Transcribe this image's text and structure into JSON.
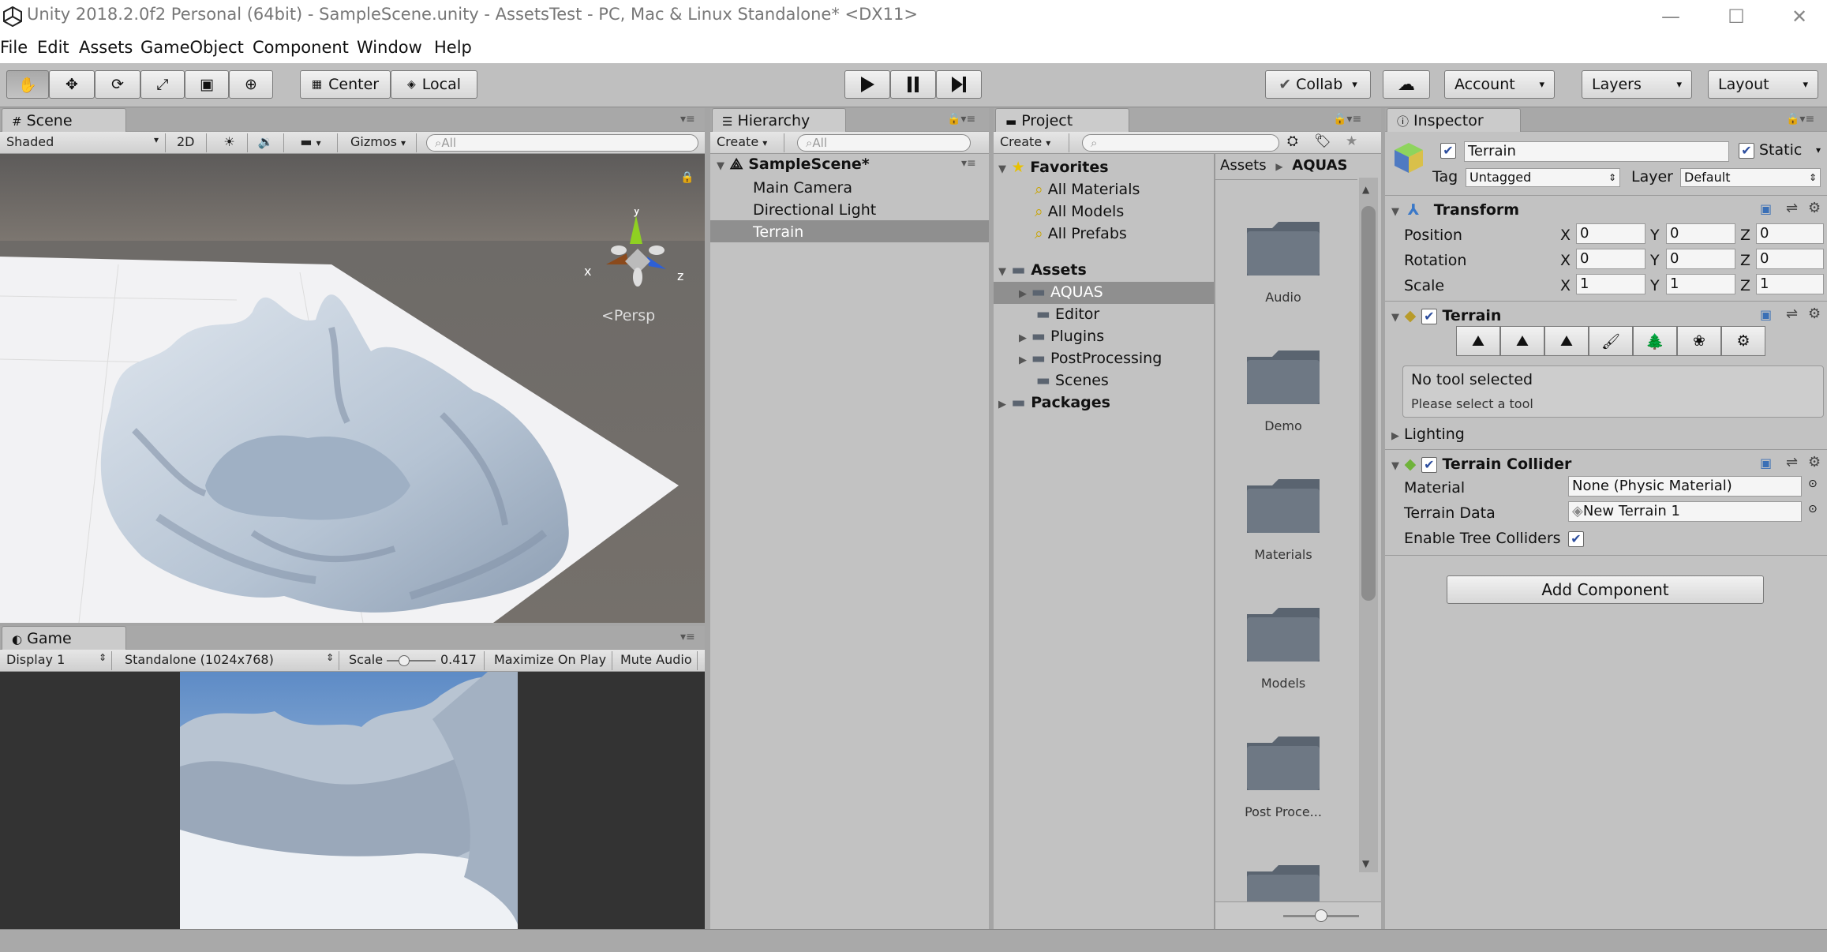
{
  "window": {
    "title": "Unity 2018.2.0f2 Personal (64bit) - SampleScene.unity - AssetsTest - PC, Mac & Linux Standalone* <DX11>",
    "minimize": "—",
    "maximize": "☐",
    "close": "✕"
  },
  "menu": [
    "File",
    "Edit",
    "Assets",
    "GameObject",
    "Component",
    "Window",
    "Help"
  ],
  "toolbar": {
    "pivot": "Center",
    "space": "Local",
    "collab": "Collab",
    "account": "Account",
    "layers": "Layers",
    "layout": "Layout"
  },
  "scene": {
    "tab": "Scene",
    "shading": "Shaded",
    "mode2d": "2D",
    "gizmos": "Gizmos",
    "search_placeholder": "All",
    "persp": "Persp",
    "axis_x": "x",
    "axis_y": "y",
    "axis_z": "z"
  },
  "game": {
    "tab": "Game",
    "display": "Display 1",
    "resolution": "Standalone (1024x768)",
    "scale_label": "Scale",
    "scale_value": "0.417",
    "scale_fraction": 0.417,
    "maximize": "Maximize On Play",
    "mute": "Mute Audio"
  },
  "hierarchy": {
    "tab": "Hierarchy",
    "create": "Create",
    "search_placeholder": "All",
    "scene": "SampleScene*",
    "items": [
      "Main Camera",
      "Directional Light",
      "Terrain"
    ],
    "selected": "Terrain"
  },
  "project": {
    "tab": "Project",
    "create": "Create",
    "favorites": "Favorites",
    "fav_items": [
      "All Materials",
      "All Models",
      "All Prefabs"
    ],
    "assets": "Assets",
    "asset_items": [
      "AQUAS",
      "Editor",
      "Plugins",
      "PostProcessing",
      "Scenes"
    ],
    "packages": "Packages",
    "breadcrumb_root": "Assets",
    "breadcrumb_sep": "▶",
    "breadcrumb_current": "AQUAS",
    "folders": [
      "Audio",
      "Demo",
      "Materials",
      "Models",
      "Post Proce..."
    ]
  },
  "inspector": {
    "tab": "Inspector",
    "object_name": "Terrain",
    "static_label": "Static",
    "tag_label": "Tag",
    "tag_value": "Untagged",
    "layer_label": "Layer",
    "layer_value": "Default",
    "transform": {
      "title": "Transform",
      "rows": [
        {
          "label": "Position",
          "x": "0",
          "y": "0",
          "z": "0"
        },
        {
          "label": "Rotation",
          "x": "0",
          "y": "0",
          "z": "0"
        },
        {
          "label": "Scale",
          "x": "1",
          "y": "1",
          "z": "1"
        }
      ],
      "x": "X",
      "y": "Y",
      "z": "Z"
    },
    "terrain": {
      "title": "Terrain",
      "no_tool": "No tool selected",
      "hint": "Please select a tool",
      "lighting": "Lighting"
    },
    "collider": {
      "title": "Terrain Collider",
      "material_label": "Material",
      "material_value": "None (Physic Material)",
      "data_label": "Terrain Data",
      "data_value": "New Terrain 1",
      "trees_label": "Enable Tree Colliders"
    },
    "add_component": "Add Component"
  },
  "colors": {
    "panel": "#c2c2c2",
    "selection": "#8f8f8f",
    "scene_sky": "#6b6a68",
    "ground": "#f3f3f5"
  }
}
